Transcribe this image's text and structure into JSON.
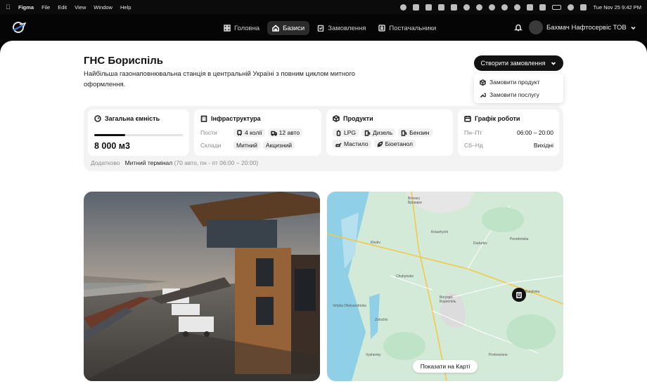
{
  "menubar": {
    "app": "Figma",
    "menus": [
      "File",
      "Edit",
      "View",
      "Window",
      "Help"
    ],
    "clock": "Tue Nov 25  9:42 PM"
  },
  "nav": {
    "items": [
      {
        "label": "Головна",
        "icon": "grid-icon"
      },
      {
        "label": "Базиси",
        "icon": "home-icon",
        "active": true
      },
      {
        "label": "Замовлення",
        "icon": "clipboard-icon"
      },
      {
        "label": "Постачальники",
        "icon": "id-card-icon"
      }
    ]
  },
  "user": {
    "name": "Бахмач Нафтосервіс ТОВ"
  },
  "page": {
    "title": "ГНС Бориспіль",
    "description": "Найбільша газонаповнювальна станція в центральній Україні з повним циклом митного оформлення."
  },
  "create": {
    "label": "Створити замовлення",
    "menu": [
      "Замовити продукт",
      "Замовити послугу"
    ]
  },
  "capacity": {
    "title": "Загальна ємність",
    "value": "8 000 м3",
    "fill_fraction": 0.35
  },
  "infra": {
    "title": "Інфраструктура",
    "posts_label": "Пости",
    "posts": [
      "4 колії",
      "12 авто"
    ],
    "warehouses_label": "Склади",
    "warehouses": [
      "Митний",
      "Акцизний"
    ]
  },
  "products": {
    "title": "Продукти",
    "row1": [
      "LPG",
      "Дизель",
      "Бензин"
    ],
    "row2": [
      "Мастило",
      "Біоетанол"
    ]
  },
  "schedule": {
    "title": "Графік роботи",
    "rows": [
      {
        "label": "Пн–Пт",
        "value": "06:00 – 20:00"
      },
      {
        "label": "Сб–Нд",
        "value": "Вихідні"
      }
    ]
  },
  "extra": {
    "label": "Додатково",
    "value": "Митний термінал",
    "note": " (70 авто, пн - пт 06:00 – 20:00)"
  },
  "map": {
    "button": "Показати на Карті",
    "labels": [
      "Brovary",
      "Бровари",
      "Boryspil",
      "Бориспіль",
      "Kniazhychi",
      "Dudarkiv",
      "Peredmistia",
      "Khotiv",
      "Velyka Oleksandrivka",
      "Zolochiv",
      "Kurylivka",
      "Prohresivne",
      "Vyshenky",
      "Chubynske"
    ]
  },
  "colors": {
    "accent": "#121212",
    "map_land": "#cfe7d6",
    "map_water": "#8fd0e6"
  }
}
